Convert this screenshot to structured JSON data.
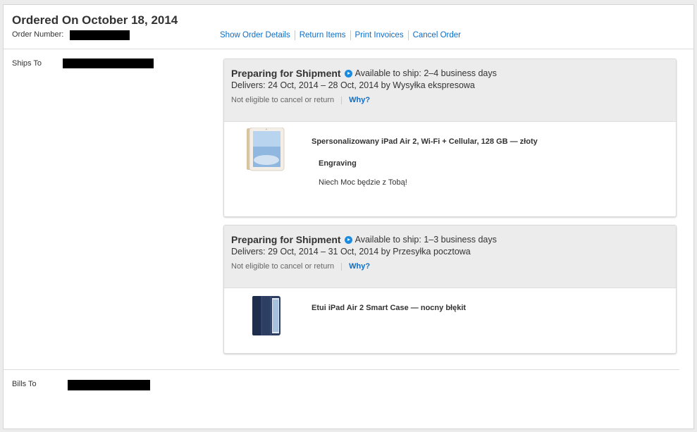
{
  "order": {
    "title": "Ordered On October 18, 2014",
    "number_label": "Order Number:"
  },
  "actions": [
    {
      "label": "Show Order Details"
    },
    {
      "label": "Return Items"
    },
    {
      "label": "Print Invoices"
    },
    {
      "label": "Cancel Order"
    }
  ],
  "ships_to_label": "Ships To",
  "bills_to_label": "Bills To",
  "shipments": [
    {
      "status": "Preparing for Shipment",
      "availability": "Available to ship: 2–4 business days",
      "delivers": "Delivers: 24 Oct, 2014 – 28 Oct, 2014 by Wysyłka ekspresowa",
      "eligibility": "Not eligible to cancel or return",
      "why": "Why?",
      "item": {
        "name": "Spersonalizowany iPad Air 2, Wi-Fi + Cellular, 128 GB — złoty",
        "engraving_label": "Engraving",
        "engraving_text": "Niech Moc będzie z Tobą!",
        "image": "ipad-gold-image"
      }
    },
    {
      "status": "Preparing for Shipment",
      "availability": "Available to ship: 1–3 business days",
      "delivers": "Delivers: 29 Oct, 2014 – 31 Oct, 2014 by Przesyłka pocztowa",
      "eligibility": "Not eligible to cancel or return",
      "why": "Why?",
      "item": {
        "name": "Etui iPad Air 2 Smart Case — nocny błękit",
        "image": "smart-case-navy-image"
      }
    }
  ],
  "colors": {
    "link": "#0b6ec7",
    "header_bg": "#ececec",
    "status_icon": "#1a8be0"
  }
}
